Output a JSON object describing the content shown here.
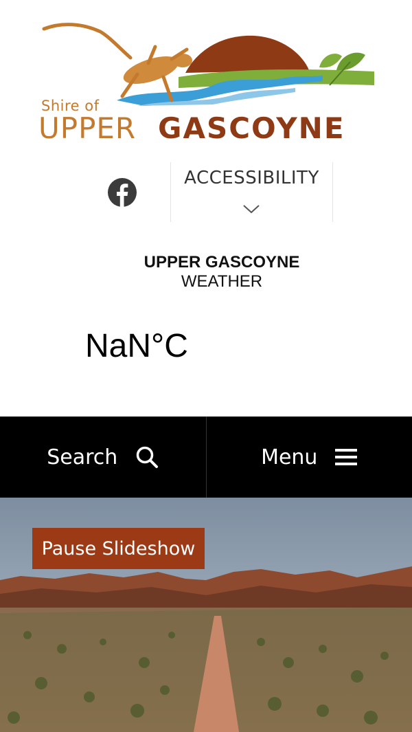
{
  "logo": {
    "small_text": "Shire of",
    "upper_text": "UPPER",
    "gascoyne_text": "GASCOYNE",
    "colors": {
      "orange": "#c47a2c",
      "brown": "#8e3a14",
      "blue": "#3c9ed6",
      "green": "#7fae3a"
    }
  },
  "social": {
    "icon": "facebook-icon",
    "color": "#3b3b3b"
  },
  "accessibility": {
    "label": "ACCESSIBILITY",
    "icon": "chevron-down-icon"
  },
  "weather": {
    "title": "UPPER GASCOYNE",
    "subtitle": "WEATHER",
    "temperature": "NaN°C"
  },
  "nav": {
    "search_label": "Search",
    "search_icon": "search-icon",
    "menu_label": "Menu",
    "menu_icon": "hamburger-menu-icon",
    "background": "#000000"
  },
  "hero": {
    "pause_label": "Pause Slideshow",
    "button_color": "#9b3a14"
  }
}
